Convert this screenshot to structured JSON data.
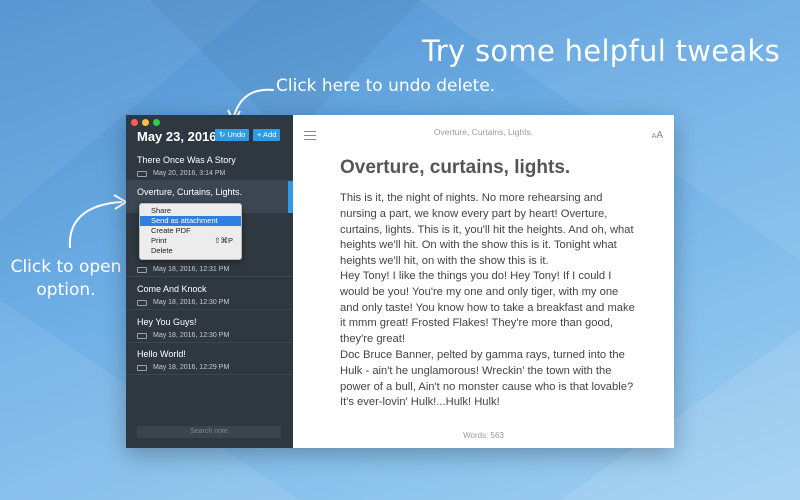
{
  "headline": "Try some helpful tweaks",
  "callouts": {
    "undo": "Click here to undo delete.",
    "open_line1": "Click to open",
    "open_line2": "option."
  },
  "sidebar": {
    "date": "May 23, 2016",
    "undo_label": "↻ Undo",
    "add_label": "+ Add",
    "search_placeholder": "Search note",
    "notes": [
      {
        "title": "There Once Was A Story",
        "meta": "May 20, 2016, 3:14 PM"
      },
      {
        "title": "Overture, Curtains, Lights.",
        "meta": ""
      },
      {
        "title": "",
        "meta": "May 18, 2016, 12:31 PM"
      },
      {
        "title": "Come And Knock",
        "meta": "May 18, 2016, 12:30 PM"
      },
      {
        "title": "Hey You Guys!",
        "meta": "May 18, 2016, 12:30 PM"
      },
      {
        "title": "Hello World!",
        "meta": "May 18, 2016, 12:29 PM"
      }
    ]
  },
  "context_menu": {
    "items": [
      "Share",
      "Send as attachment",
      "Create PDF",
      "Print",
      "Delete"
    ],
    "print_shortcut": "⇧⌘P"
  },
  "editor": {
    "header": "Overture, Curtains, Lights.",
    "font_icon_small": "A",
    "font_icon_large": "A",
    "title": "Overture, curtains, lights.",
    "paragraphs": [
      "This is it, the night of nights. No more rehearsing and nursing a part, we know every part by heart! Overture, curtains, lights. This is it, you'll hit the heights. And oh, what heights we'll hit. On with the show this is it. Tonight what heights we'll hit, on with the show this is it.",
      "Hey Tony! I like the things you do! Hey Tony! If I could I would be you! You're my one and only tiger, with my one and only taste! You know how to take a breakfast and make it mmm great! Frosted Flakes! They're more than good, they're great!",
      "Doc Bruce Banner, pelted by gamma rays, turned into the Hulk - ain't he unglamorous! Wreckin' the town with the power of a bull, Ain't no monster cause who is that lovable? It's ever-lovin' Hulk!...Hulk! Hulk!"
    ],
    "word_count": "Words: 563"
  },
  "colors": {
    "accent": "#2f9be4",
    "sidebar_bg": "#2f3740",
    "menu_highlight": "#2f7ee0"
  }
}
